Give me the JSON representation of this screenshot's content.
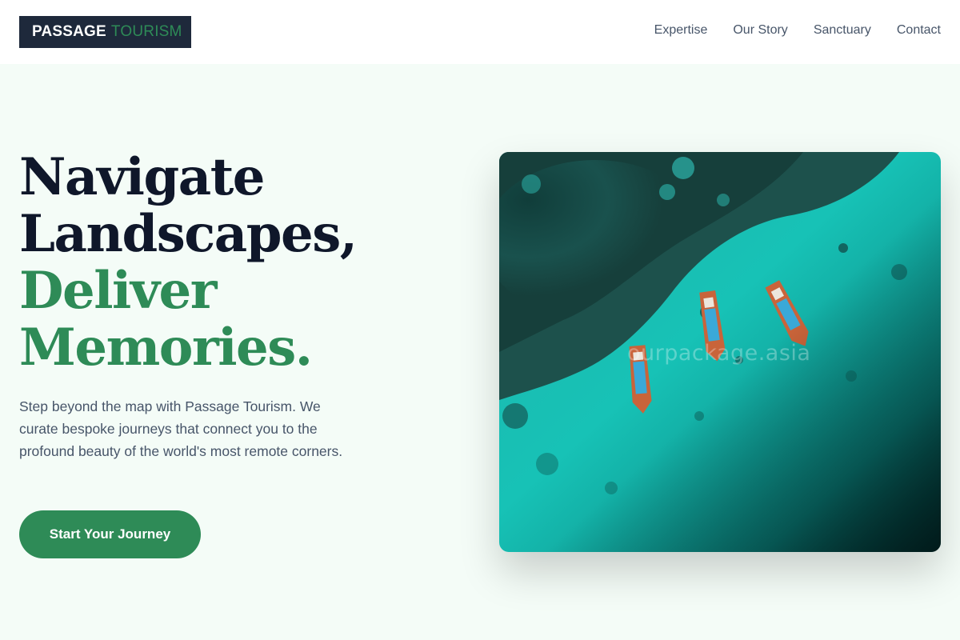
{
  "brand": {
    "name_part1": "PASSAGE",
    "name_part2": "TOURISM"
  },
  "nav": {
    "items": [
      {
        "label": "Expertise"
      },
      {
        "label": "Our Story"
      },
      {
        "label": "Sanctuary"
      },
      {
        "label": "Contact"
      }
    ]
  },
  "hero": {
    "title_line1": "Navigate",
    "title_line2": "Landscapes,",
    "title_line3": "Deliver",
    "title_line4": "Memories.",
    "description": "Step beyond the map with Passage Tourism. We curate bespoke journeys that connect you to the profound beauty of the world's most remote corners.",
    "cta_label": "Start Your Journey"
  },
  "image": {
    "watermark": "ourpackage.asia"
  },
  "colors": {
    "brand_dark": "#1e293b",
    "accent_green": "#2e8b57",
    "page_bg": "#f4fcf7",
    "text_dark": "#0f172a",
    "text_muted": "#475569"
  }
}
